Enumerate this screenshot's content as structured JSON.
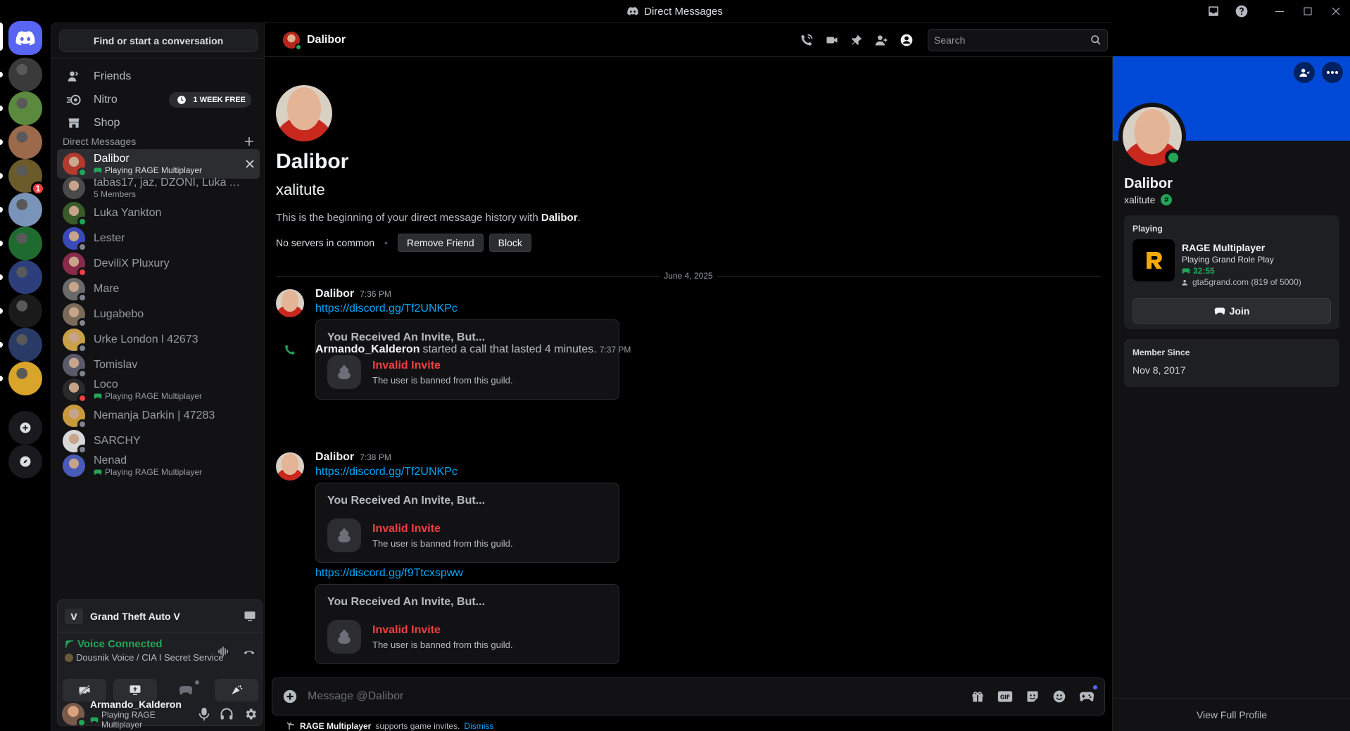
{
  "window": {
    "title": "Direct Messages"
  },
  "colors": {
    "accent": "#5865f2",
    "online": "#23a559",
    "danger": "#f23f43",
    "link": "#00a8fc",
    "banner": "#0049d6"
  },
  "rail": {
    "home_icon": "discord-logo-icon",
    "add_server_icon": "plus-icon",
    "discover_icon": "compass-icon",
    "servers": [
      {
        "name": "server-1",
        "color": "#3a3a3a"
      },
      {
        "name": "server-2",
        "color": "#5b8a3e"
      },
      {
        "name": "server-3",
        "color": "#9b6a4a"
      },
      {
        "name": "server-4",
        "color": "#6b5a2a",
        "badge": "1"
      },
      {
        "name": "server-5",
        "color": "#7a93b8"
      },
      {
        "name": "server-6",
        "color": "#1f6b2f"
      },
      {
        "name": "server-7",
        "color": "#2d3f7a"
      },
      {
        "name": "server-8",
        "color": "#1a1a1a"
      },
      {
        "name": "server-9",
        "color": "#2a3a66"
      },
      {
        "name": "server-10",
        "color": "#d8a42a"
      }
    ]
  },
  "sidebar": {
    "search_label": "Find or start a conversation",
    "nav": {
      "friends": "Friends",
      "nitro": "Nitro",
      "nitro_badge": "1 WEEK FREE",
      "shop": "Shop"
    },
    "dm_header": "Direct Messages",
    "dms": [
      {
        "name": "Dalibor",
        "sub": "Playing RAGE Multiplayer",
        "status": "online",
        "color": "#b33a2e"
      },
      {
        "name": "tabas17, jaz, DZONI, Luka Ashf...",
        "sub": "5 Members",
        "status": "",
        "color": "#4a4a4a"
      },
      {
        "name": "Luka Yankton",
        "sub": "",
        "status": "online",
        "color": "#3a5a2a"
      },
      {
        "name": "Lester",
        "sub": "",
        "status": "offline",
        "color": "#3a4ab8"
      },
      {
        "name": "DeviliX Pluxury",
        "sub": "",
        "status": "dnd",
        "color": "#8a2a4a"
      },
      {
        "name": "Mare",
        "sub": "",
        "status": "offline",
        "color": "#6a6a6a"
      },
      {
        "name": "Lugabebo",
        "sub": "",
        "status": "offline",
        "color": "#7a6a5a"
      },
      {
        "name": "Urke London l 42673",
        "sub": "",
        "status": "offline",
        "color": "#c8a04a"
      },
      {
        "name": "Tomislav",
        "sub": "",
        "status": "offline",
        "color": "#5a5a6a"
      },
      {
        "name": "Loco",
        "sub": "Playing RAGE Multiplayer",
        "status": "dnd",
        "color": "#2a2a2a"
      },
      {
        "name": "Nemanja Darkin | 47283",
        "sub": "",
        "status": "offline",
        "color": "#c89a3a"
      },
      {
        "name": "SARCHY",
        "sub": "",
        "status": "offline",
        "color": "#d8d8d8"
      },
      {
        "name": "Nenad",
        "sub": "Playing RAGE Multiplayer",
        "status": "",
        "color": "#4a5ab8"
      }
    ]
  },
  "panel": {
    "game": "Grand Theft Auto V",
    "voice_title": "Voice Connected",
    "voice_channel": "Dousnik Voice / CIA I Secret Service",
    "user_name": "Armando_Kalderon",
    "user_status": "Playing RAGE Multiplayer"
  },
  "chat": {
    "header_name": "Dalibor",
    "search_placeholder": "Search",
    "welcome": {
      "name": "Dalibor",
      "username": "xalitute",
      "history_prefix": "This is the beginning of your direct message history with ",
      "history_name": "Dalibor",
      "history_suffix": ".",
      "no_servers": "No servers in common",
      "remove_friend": "Remove Friend",
      "block": "Block"
    },
    "date_divider": "June 4, 2025",
    "messages": [
      {
        "author": "Dalibor",
        "time": "7:36 PM",
        "link": "https://discord.gg/Tf2UNKPc",
        "invite": {
          "heading": "You Received An Invite, But...",
          "title": "Invalid Invite",
          "subtitle": "The user is banned from this guild."
        }
      },
      {
        "author": "Dalibor",
        "time": "7:38 PM",
        "link": "https://discord.gg/Tf2UNKPc",
        "invite": {
          "heading": "You Received An Invite, But...",
          "title": "Invalid Invite",
          "subtitle": "The user is banned from this guild."
        },
        "link2": "https://discord.gg/f9Ttcxspww",
        "invite2": {
          "heading": "You Received An Invite, But...",
          "title": "Invalid Invite",
          "subtitle": "The user is banned from this guild."
        }
      }
    ],
    "call": {
      "name": "Armando_Kalderon",
      "text": "started a call that lasted 4 minutes.",
      "time": "7:37 PM"
    },
    "composer_placeholder": "Message @Dalibor",
    "hint": {
      "game": "RAGE Multiplayer",
      "text": "supports game invites.",
      "dismiss": "Dismiss"
    }
  },
  "profile": {
    "name": "Dalibor",
    "username": "xalitute",
    "playing_label": "Playing",
    "game_title": "RAGE Multiplayer",
    "game_detail": "Playing Grand Role Play",
    "game_time": "32:55",
    "game_server": "gta5grand.com (819 of 5000)",
    "join": "Join",
    "member_since_label": "Member Since",
    "member_since": "Nov 8, 2017",
    "view_full": "View Full Profile"
  }
}
